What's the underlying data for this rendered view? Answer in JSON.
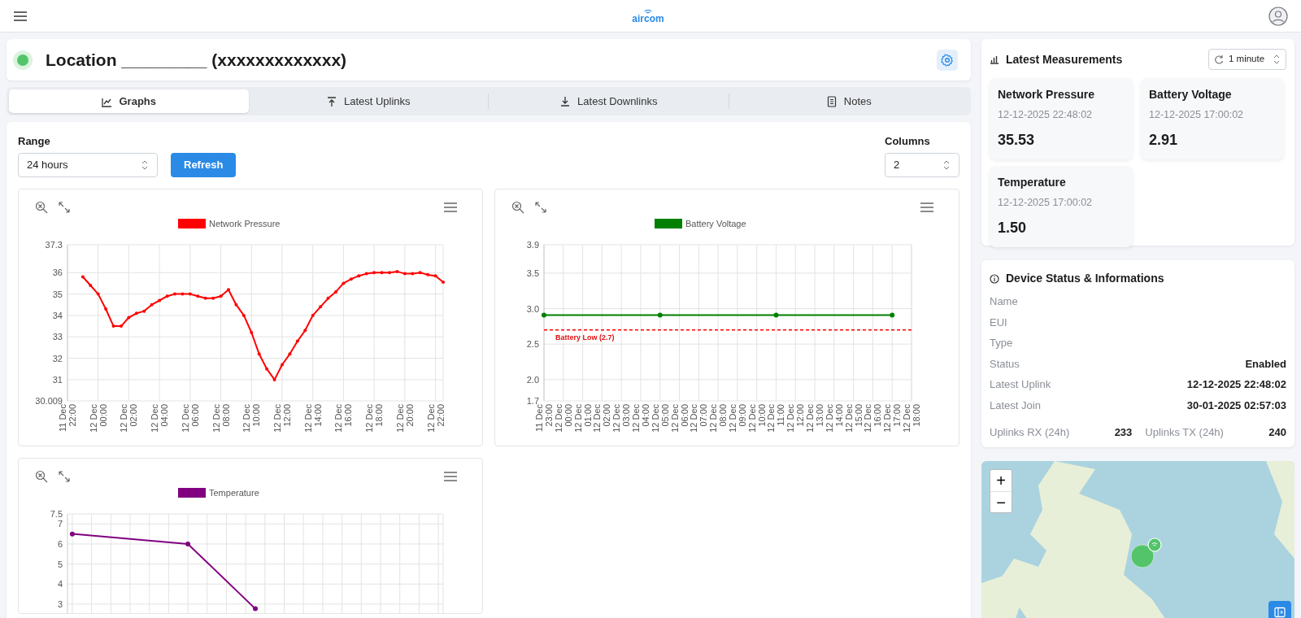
{
  "navbar": {
    "logo": "aircom"
  },
  "header": {
    "online": true,
    "title": "Location _________ (xxxxxxxxxxxxx)"
  },
  "tabs": [
    {
      "label": "Graphs",
      "selected": true
    },
    {
      "label": "Latest Uplinks",
      "selected": false
    },
    {
      "label": "Latest Downlinks",
      "selected": false
    },
    {
      "label": "Notes",
      "selected": false
    }
  ],
  "controls": {
    "range_label": "Range",
    "range_value": "24 hours",
    "refresh": "Refresh",
    "columns_label": "Columns",
    "columns_value": "2"
  },
  "charts": [
    {
      "chart_data": {
        "type": "line",
        "grid": true,
        "ylim": [
          30.009,
          37.3
        ],
        "categories": [
          "11 Dec 22:00",
          null,
          null,
          null,
          "12 Dec 00:00",
          null,
          null,
          null,
          "12 Dec 02:00",
          null,
          null,
          null,
          "12 Dec 04:00",
          null,
          null,
          null,
          "12 Dec 06:00",
          null,
          null,
          null,
          "12 Dec 08:00",
          null,
          null,
          null,
          "12 Dec 10:00",
          null,
          null,
          null,
          "12 Dec 12:00",
          null,
          null,
          null,
          "12 Dec 14:00",
          null,
          null,
          null,
          "12 Dec 16:00",
          null,
          null,
          null,
          "12 Dec 18:00",
          null,
          null,
          null,
          "12 Dec 20:00",
          null,
          null,
          null,
          "12 Dec 22:00",
          null
        ],
        "yticks": [
          30.009,
          31,
          32,
          33,
          34,
          35,
          36,
          37.3
        ],
        "series": [
          {
            "name": "Network Pressure",
            "color": "#ff0000",
            "marker": true,
            "values": [
              null,
              null,
              35.8,
              35.4,
              35.0,
              34.3,
              33.5,
              33.5,
              33.9,
              34.1,
              34.2,
              34.5,
              34.7,
              34.9,
              35.0,
              35.0,
              35.0,
              34.9,
              34.8,
              34.8,
              34.9,
              35.2,
              34.5,
              34.0,
              33.2,
              32.2,
              31.5,
              31.0,
              31.7,
              32.2,
              32.8,
              33.3,
              34.0,
              34.4,
              34.8,
              35.1,
              35.5,
              35.7,
              35.85,
              35.95,
              36.0,
              36.0,
              36.0,
              36.05,
              35.95,
              35.95,
              36.0,
              35.9,
              35.85,
              35.55
            ]
          }
        ]
      }
    },
    {
      "chart_data": {
        "type": "line",
        "grid": true,
        "ylim": [
          1.7,
          3.9
        ],
        "categories": [
          "11 Dec 23:00",
          "12 Dec 00:00",
          "12 Dec 01:00",
          "12 Dec 02:00",
          "12 Dec 03:00",
          "12 Dec 04:00",
          "12 Dec 05:00",
          "12 Dec 06:00",
          "12 Dec 07:00",
          "12 Dec 08:00",
          "12 Dec 09:00",
          "12 Dec 10:00",
          "12 Dec 11:00",
          "12 Dec 12:00",
          "12 Dec 13:00",
          "12 Dec 14:00",
          "12 Dec 15:00",
          "12 Dec 16:00",
          "12 Dec 17:00",
          "12 Dec 18:00"
        ],
        "yticks": [
          {
            "value": 1.7,
            "label": "1.7"
          },
          {
            "value": 2,
            "label": "2.0"
          },
          {
            "value": 2.5,
            "label": "2.5"
          },
          {
            "value": 3,
            "label": "3.0"
          },
          {
            "value": 3.5,
            "label": "3.5"
          },
          {
            "value": 3.9,
            "label": "3.9"
          }
        ],
        "series": [
          {
            "name": "Battery Voltage",
            "color": "#008000",
            "marker": true,
            "values": [
              2.91,
              null,
              null,
              null,
              null,
              null,
              2.91,
              null,
              null,
              null,
              null,
              null,
              2.91,
              null,
              null,
              null,
              null,
              null,
              2.91,
              null
            ]
          }
        ],
        "ref_lines": [
          {
            "axis": "y",
            "value": 2.7,
            "label": "Battery Low (2.7)"
          }
        ]
      }
    },
    {
      "chart_data": {
        "type": "line",
        "grid": true,
        "ylim": [
          2.55,
          7.5
        ],
        "categories": [
          null,
          null,
          null,
          null,
          null,
          null,
          null,
          null,
          null,
          null,
          null,
          null,
          null,
          null,
          null,
          null,
          null,
          null,
          null,
          null,
          null,
          null,
          null,
          null,
          null,
          null,
          null,
          null,
          null,
          null,
          null,
          null,
          null,
          null,
          null,
          null,
          null,
          null,
          null
        ],
        "yticks": [
          3,
          4,
          5,
          6,
          7,
          7.5
        ],
        "series": [
          {
            "name": "Temperature",
            "color": "#800080",
            "marker": true,
            "values": [
              6.5,
              null,
              null,
              null,
              null,
              null,
              null,
              null,
              null,
              null,
              null,
              null,
              6.0,
              null,
              null,
              null,
              null,
              null,
              null,
              2.77,
              null,
              null,
              null,
              null,
              null,
              null,
              null,
              null,
              null,
              null,
              null,
              null,
              null,
              null,
              null,
              null,
              null,
              null,
              null
            ]
          }
        ]
      }
    }
  ],
  "measurements": {
    "title": "Latest Measurements",
    "refresh_value": "1 minute",
    "items": [
      {
        "name": "Network Pressure",
        "time": "12-12-2025 22:48:02",
        "value": "35.53"
      },
      {
        "name": "Battery Voltage",
        "time": "12-12-2025 17:00:02",
        "value": "2.91"
      },
      {
        "name": "Temperature",
        "time": "12-12-2025 17:00:02",
        "value": "1.50"
      }
    ]
  },
  "device": {
    "title": "Device Status & Informations",
    "fields": [
      {
        "label": "Name"
      },
      {
        "label": "EUI"
      },
      {
        "label": "Type"
      },
      {
        "label": "Status",
        "value": "Enabled"
      },
      {
        "label": "Latest Uplink",
        "value": "12-12-2025 22:48:02"
      },
      {
        "label": "Latest Join",
        "value": "30-01-2025 02:57:03"
      }
    ],
    "counters": [
      {
        "label": "Uplinks RX (24h)",
        "value": "233"
      },
      {
        "label": "Uplinks TX (24h)",
        "value": "240"
      }
    ]
  },
  "map": {
    "zoom_in": "+",
    "zoom_out": "−"
  }
}
